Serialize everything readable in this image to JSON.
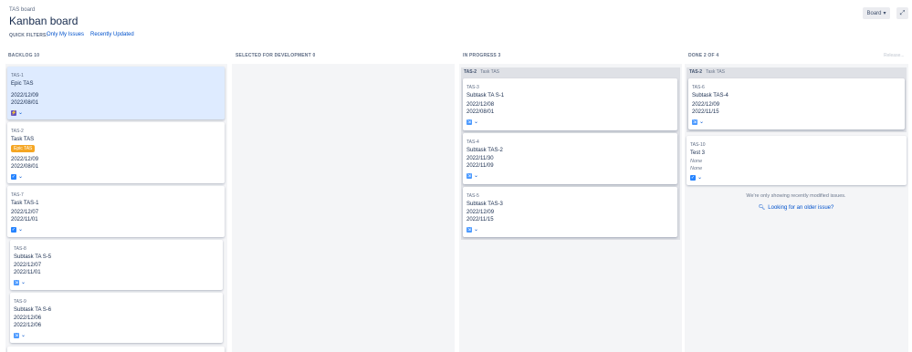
{
  "header": {
    "breadcrumb": "TAS board",
    "title": "Kanban board",
    "quick_filters_label": "QUICK FILTERS:",
    "filters": [
      "Only My Issues",
      "Recently Updated"
    ],
    "board_button": "Board",
    "expand_icon": "expand-icon"
  },
  "columns": [
    {
      "title": "BACKLOG 10"
    },
    {
      "title": "SELECTED FOR DEVELOPMENT 0"
    },
    {
      "title": "IN PROGRESS 3"
    },
    {
      "title": "DONE 2 OF 4",
      "action": "Release..."
    }
  ],
  "backlog": [
    {
      "key": "TAS-1",
      "summary": "Epic TAS",
      "dates": [
        "2022/12/09",
        "2022/08/01"
      ],
      "type": "epic",
      "selected": true
    },
    {
      "key": "TAS-2",
      "summary": "Task TAS",
      "epic": "Epic TAS",
      "dates": [
        "2022/12/09",
        "2022/08/01"
      ],
      "type": "task"
    },
    {
      "key": "TAS-7",
      "summary": "Task TAS-1",
      "dates": [
        "2022/12/07",
        "2022/11/01"
      ],
      "type": "task"
    },
    {
      "key": "TAS-8",
      "summary": "Subtask TA S-5",
      "dates": [
        "2022/12/07",
        "2022/11/01"
      ],
      "type": "subtask"
    },
    {
      "key": "TAS-9",
      "summary": "Subtask TA S-6",
      "dates": [
        "2022/12/06",
        "2022/12/06"
      ],
      "type": "subtask"
    }
  ],
  "in_progress": {
    "lane": {
      "key": "TAS-2",
      "name": "Task TAS"
    },
    "cards": [
      {
        "key": "TAS-3",
        "summary": "Subtask TA S-1",
        "dates": [
          "2022/12/08",
          "2022/08/01"
        ],
        "type": "subtask"
      },
      {
        "key": "TAS-4",
        "summary": "Subtask TAS-2",
        "dates": [
          "2022/11/30",
          "2022/11/09"
        ],
        "type": "subtask"
      },
      {
        "key": "TAS-5",
        "summary": "Subtask TAS-3",
        "dates": [
          "2022/12/09",
          "2022/11/15"
        ],
        "type": "subtask"
      }
    ]
  },
  "done": {
    "lane": {
      "key": "TAS-2",
      "name": "Task TAS"
    },
    "cards": [
      {
        "key": "TAS-6",
        "summary": "Subtask TAS-4",
        "dates": [
          "2022/12/09",
          "2022/11/15"
        ],
        "type": "subtask"
      },
      {
        "key": "TAS-10",
        "summary": "Test 3",
        "dates": [
          "None",
          "None"
        ],
        "type": "task"
      }
    ],
    "info": "We're only showing recently modified issues.",
    "older_link": "Looking for an older issue?"
  },
  "colors": {
    "accent": "#0052cc",
    "epic_lozenge": "#f5a623",
    "selected_card": "#deebff",
    "column_bg": "#f4f5f7"
  }
}
